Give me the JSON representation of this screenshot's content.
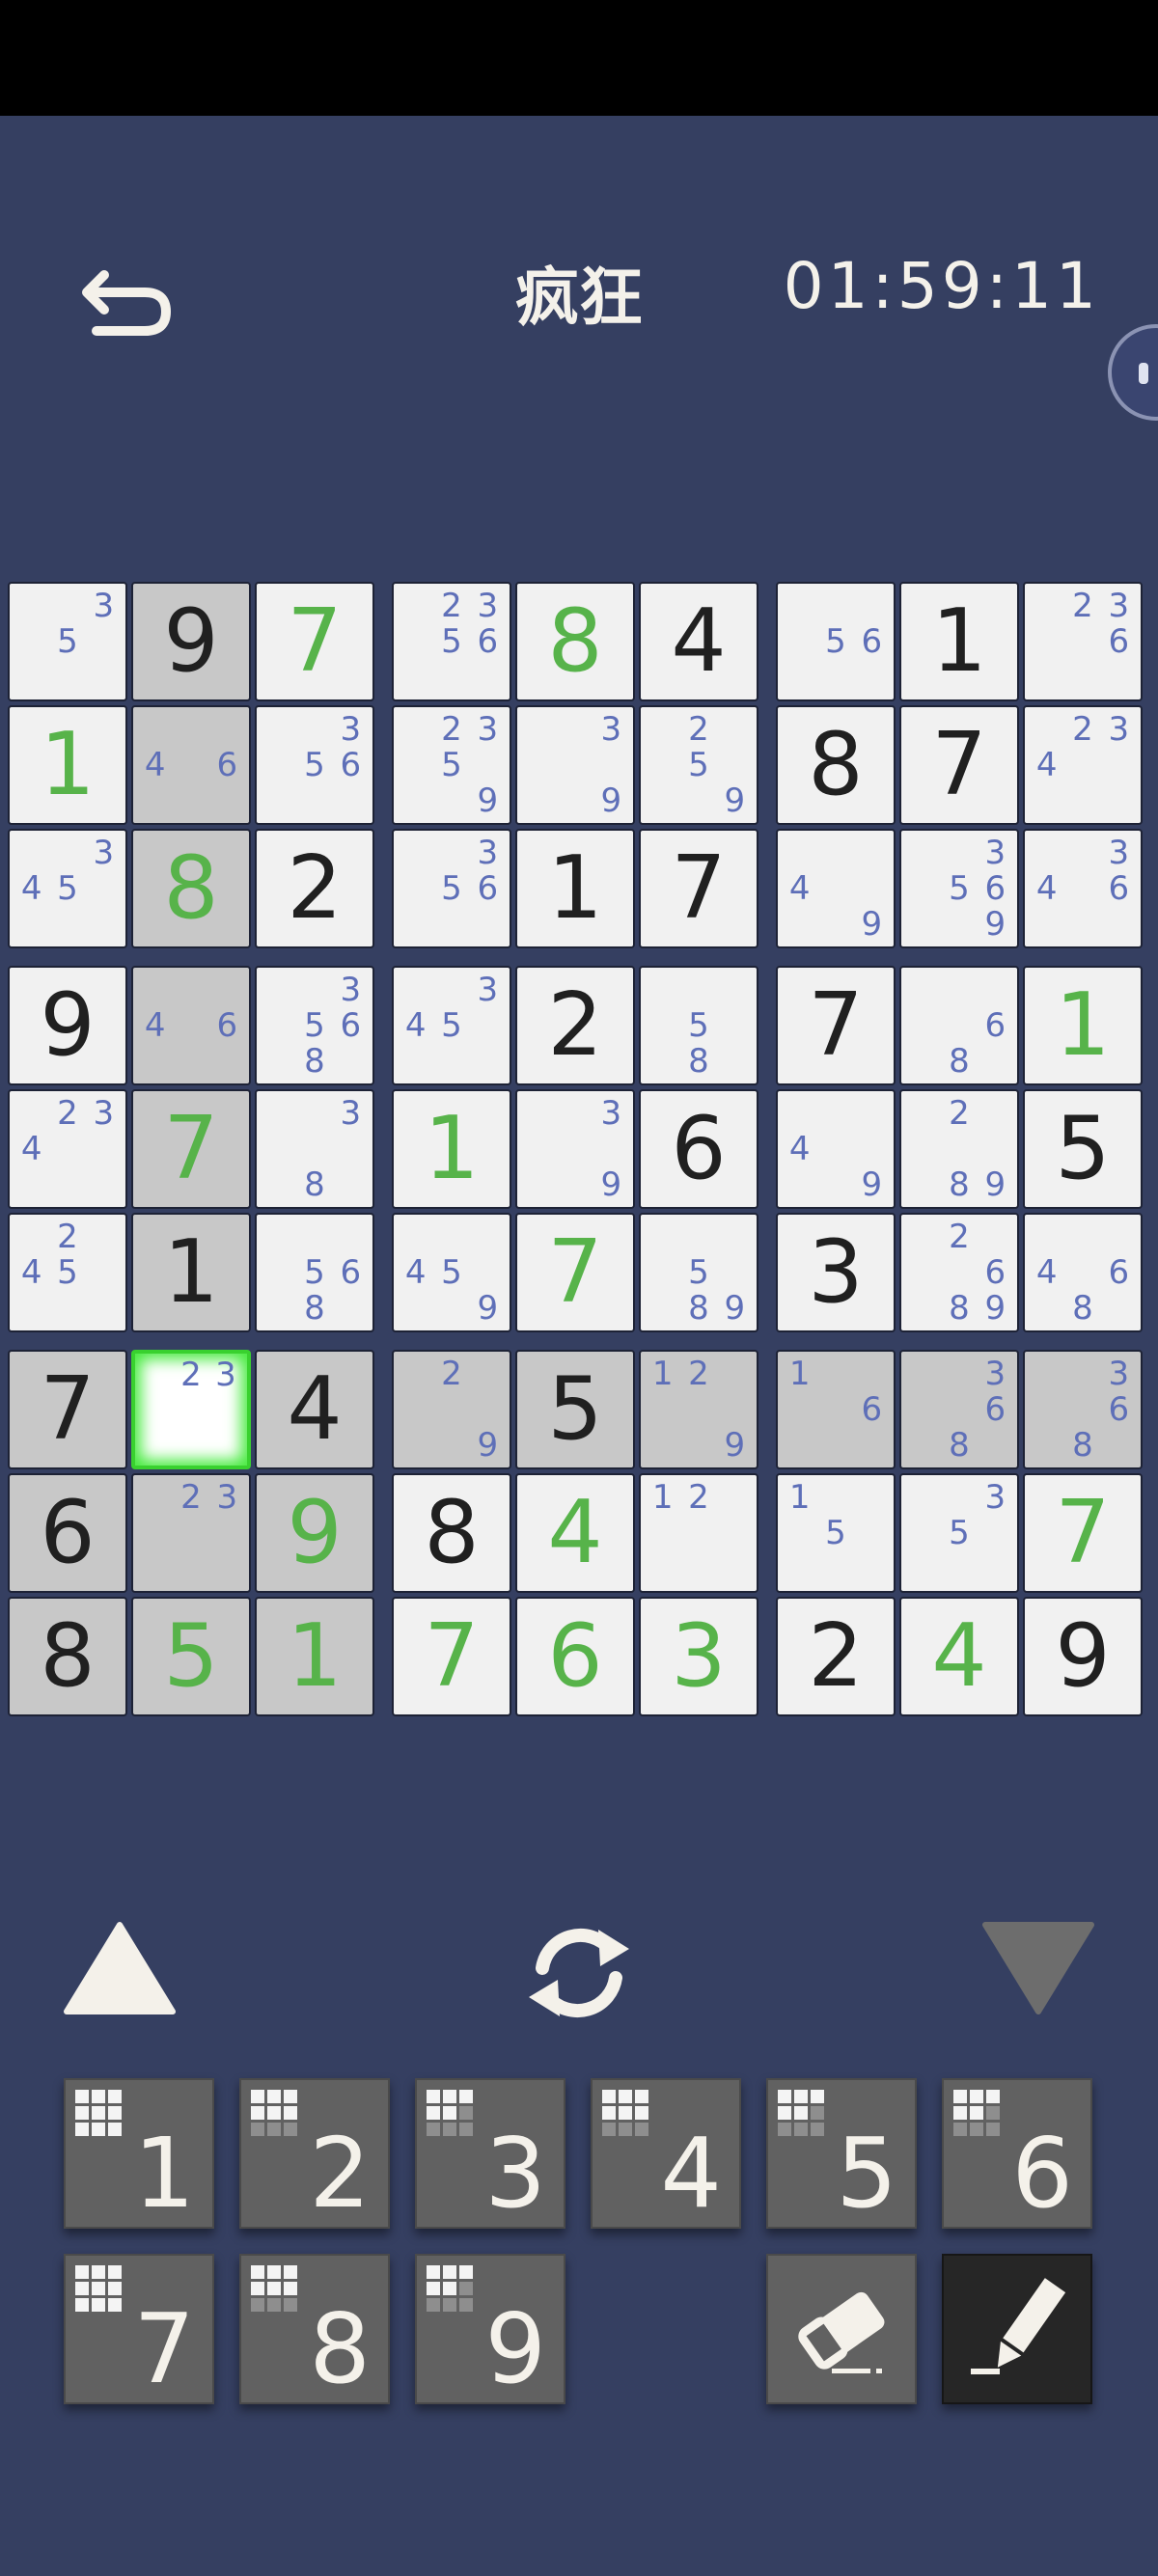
{
  "header": {
    "title": "疯狂",
    "timer": "01:59:11"
  },
  "icons": {
    "back": "undo-arrow-icon",
    "chat": "chat-bubble-icon",
    "prev": "triangle-up-icon",
    "rotate": "rotate-icon",
    "next": "triangle-down-icon",
    "eraser": "eraser-icon",
    "pencil": "pencil-icon"
  },
  "board": {
    "rows": [
      [
        {
          "n": [
            5,
            3
          ]
        },
        {
          "v": 9,
          "g": true
        },
        {
          "v": 7
        },
        {
          "n": [
            2,
            3,
            5,
            6
          ]
        },
        {
          "v": 8
        },
        {
          "v": 4,
          "g": true
        },
        {
          "n": [
            5,
            6
          ]
        },
        {
          "v": 1,
          "g": true
        },
        {
          "n": [
            2,
            3,
            6
          ]
        }
      ],
      [
        {
          "v": 1
        },
        {
          "n": [
            4,
            6
          ]
        },
        {
          "n": [
            3,
            5,
            6
          ]
        },
        {
          "n": [
            2,
            3,
            5,
            9
          ]
        },
        {
          "n": [
            3,
            9
          ]
        },
        {
          "n": [
            2,
            5,
            9
          ]
        },
        {
          "v": 8,
          "g": true
        },
        {
          "v": 7,
          "g": true
        },
        {
          "n": [
            2,
            3,
            4
          ]
        }
      ],
      [
        {
          "n": [
            3,
            4,
            5
          ]
        },
        {
          "v": 8
        },
        {
          "v": 2,
          "g": true
        },
        {
          "n": [
            3,
            5,
            6
          ]
        },
        {
          "v": 1,
          "g": true
        },
        {
          "v": 7,
          "g": true
        },
        {
          "n": [
            4,
            9
          ]
        },
        {
          "n": [
            3,
            5,
            6,
            9
          ]
        },
        {
          "n": [
            3,
            4,
            6
          ]
        }
      ],
      [
        {
          "v": 9,
          "g": true
        },
        {
          "n": [
            4,
            6
          ]
        },
        {
          "n": [
            3,
            5,
            6,
            8
          ]
        },
        {
          "n": [
            3,
            4,
            5
          ]
        },
        {
          "v": 2,
          "g": true
        },
        {
          "n": [
            5,
            8
          ]
        },
        {
          "v": 7,
          "g": true
        },
        {
          "n": [
            6,
            8
          ]
        },
        {
          "v": 1
        }
      ],
      [
        {
          "n": [
            2,
            3,
            4
          ]
        },
        {
          "v": 7
        },
        {
          "n": [
            3,
            8
          ]
        },
        {
          "v": 1
        },
        {
          "n": [
            3,
            9
          ]
        },
        {
          "v": 6,
          "g": true
        },
        {
          "n": [
            4,
            9
          ]
        },
        {
          "n": [
            2,
            8,
            9
          ]
        },
        {
          "v": 5,
          "g": true
        }
      ],
      [
        {
          "n": [
            2,
            4,
            5
          ]
        },
        {
          "v": 1,
          "g": true
        },
        {
          "n": [
            5,
            6,
            8
          ]
        },
        {
          "n": [
            4,
            5,
            9
          ]
        },
        {
          "v": 7
        },
        {
          "n": [
            5,
            8,
            9
          ]
        },
        {
          "v": 3,
          "g": true
        },
        {
          "n": [
            2,
            6,
            8,
            9
          ]
        },
        {
          "n": [
            4,
            6,
            8
          ]
        }
      ],
      [
        {
          "v": 7,
          "g": true
        },
        {
          "n": [
            2,
            3
          ],
          "sel": true
        },
        {
          "v": 4,
          "g": true
        },
        {
          "n": [
            2,
            9
          ]
        },
        {
          "v": 5,
          "g": true
        },
        {
          "n": [
            1,
            2,
            9
          ]
        },
        {
          "n": [
            1,
            6
          ]
        },
        {
          "n": [
            3,
            6,
            8
          ]
        },
        {
          "n": [
            3,
            6,
            8
          ]
        }
      ],
      [
        {
          "v": 6,
          "g": true
        },
        {
          "n": [
            2,
            3
          ]
        },
        {
          "v": 9
        },
        {
          "v": 8,
          "g": true
        },
        {
          "v": 4
        },
        {
          "n": [
            1,
            2
          ]
        },
        {
          "n": [
            1,
            5
          ]
        },
        {
          "n": [
            3,
            5
          ]
        },
        {
          "v": 7
        }
      ],
      [
        {
          "v": 8,
          "g": true
        },
        {
          "v": 5
        },
        {
          "v": 1
        },
        {
          "v": 7
        },
        {
          "v": 6
        },
        {
          "v": 3
        },
        {
          "v": 2,
          "g": true
        },
        {
          "v": 4
        },
        {
          "v": 9,
          "g": true
        }
      ]
    ]
  },
  "numpad": [
    {
      "digit": "1",
      "remaining": 9
    },
    {
      "digit": "2",
      "remaining": 6
    },
    {
      "digit": "3",
      "remaining": 5
    },
    {
      "digit": "4",
      "remaining": 6
    },
    {
      "digit": "5",
      "remaining": 5
    },
    {
      "digit": "6",
      "remaining": 5
    },
    {
      "digit": "7",
      "remaining": 9
    },
    {
      "digit": "8",
      "remaining": 6
    },
    {
      "digit": "9",
      "remaining": 5
    }
  ],
  "colors": {
    "background": "#353f61",
    "given": "#202020",
    "user": "#57b34a",
    "notes": "#5e6fb8",
    "highlight": "#c8c8c8",
    "selected": "#44ea3c"
  }
}
